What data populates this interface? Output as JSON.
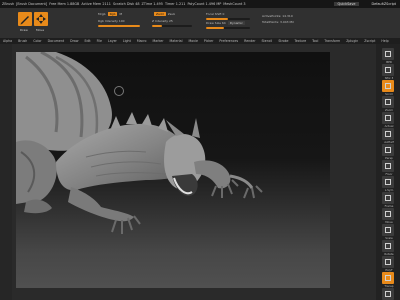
{
  "titlebar": {
    "app_name": "ZBrush",
    "document": "[Brush Document]",
    "free_mem": "Free Mem 1.88GB",
    "active_mem": "Active Mem 2111",
    "scratch_disk": "Scratch Disk 48",
    "ztime": "ZTime 1.495",
    "timer": "Timer 1.211",
    "poly_count": "PolyCount 1.496 MP",
    "mesh_count": "MeshCount 3",
    "quicksave": "QuickSave",
    "default_zscript": "DefaultZScript"
  },
  "toolbar": {
    "brush_label": "Draw",
    "sym_label": "Move",
    "mrgb_label": "Mrgb",
    "rgb_label": "Rgb",
    "rgb_value": "Rgb",
    "m_label": "M",
    "rgb_intensity_label": "Rgb Intensity 100",
    "zadd_label": "Zadd",
    "zsub_label": "Zsub",
    "z_intensity_label": "Z Intensity 25",
    "focal_shift_label": "Focal Shift 0",
    "draw_size_label": "Draw Size 64",
    "dynamic_label": "Dynamic",
    "active_points_label": "ActivePoints: 14.310",
    "total_points_label": "TotalPoints: 3.043 Mil"
  },
  "menubar": {
    "items": [
      "Alpha",
      "Brush",
      "Color",
      "Document",
      "Draw",
      "Edit",
      "File",
      "Layer",
      "Light",
      "Macro",
      "Marker",
      "Material",
      "Movie",
      "Picker",
      "Preferences",
      "Render",
      "Stencil",
      "Stroke",
      "Texture",
      "Tool",
      "Transform",
      "Zplugin",
      "Zscript",
      "Help"
    ]
  },
  "rightbar": {
    "buttons": [
      {
        "icon": "bpr-icon",
        "label": "BPR"
      },
      {
        "icon": "spix-icon",
        "label": "SPix 3"
      },
      {
        "icon": "scroll-icon",
        "label": "Scroll"
      },
      {
        "icon": "zoom-icon",
        "label": "Zoom"
      },
      {
        "icon": "actual-icon",
        "label": "Actual"
      },
      {
        "icon": "aahalf-icon",
        "label": "AAHalf"
      },
      {
        "icon": "persp-icon",
        "label": "Persp"
      },
      {
        "icon": "floor-icon",
        "label": "Floor"
      },
      {
        "icon": "lsym-icon",
        "label": "L.Sym"
      },
      {
        "icon": "frame-icon",
        "label": "Frame"
      },
      {
        "icon": "move-icon",
        "label": "Move"
      },
      {
        "icon": "scale-icon",
        "label": "Scale"
      },
      {
        "icon": "rotate-icon",
        "label": "Rotate"
      },
      {
        "icon": "polyf-icon",
        "label": "PolyF"
      },
      {
        "icon": "transp-icon",
        "label": "Transp"
      },
      {
        "icon": "solo-icon",
        "label": "Solo"
      }
    ]
  },
  "accent_color": "#e88a1a"
}
